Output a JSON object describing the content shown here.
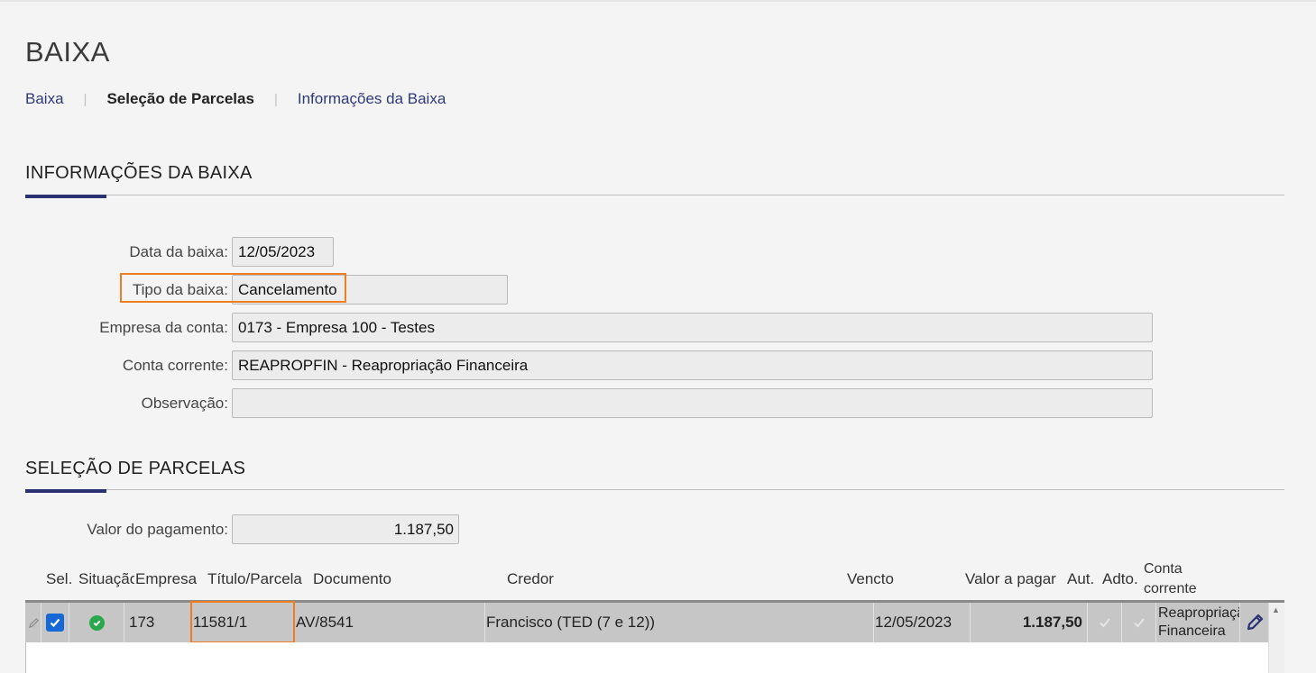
{
  "page": {
    "title": "BAIXA"
  },
  "breadcrumb": {
    "items": [
      {
        "label": "Baixa"
      },
      {
        "label": "Seleção de Parcelas"
      },
      {
        "label": "Informações da Baixa"
      }
    ],
    "separator": "|"
  },
  "info_section": {
    "title": "INFORMAÇÕES DA BAIXA",
    "data_baixa": {
      "label": "Data da baixa:",
      "value": "12/05/2023"
    },
    "tipo_baixa": {
      "label": "Tipo da baixa:",
      "value": "Cancelamento"
    },
    "empresa": {
      "label": "Empresa da conta:",
      "value": "0173 - Empresa 100 - Testes"
    },
    "conta": {
      "label": "Conta corrente:",
      "value": "REAPROPFIN - Reapropriação Financeira"
    },
    "observacao": {
      "label": "Observação:",
      "value": ""
    }
  },
  "selection_section": {
    "title": "SELEÇÃO DE PARCELAS",
    "valor_pagamento": {
      "label": "Valor do pagamento:",
      "value": "1.187,50"
    },
    "columns": {
      "sel": "Sel.",
      "situacao": "Situação",
      "empresa": "Empresa",
      "titulo": "Título/Parcela",
      "documento": "Documento",
      "credor": "Credor",
      "vencto": "Vencto",
      "valor": "Valor a pagar",
      "aut": "Aut.",
      "adto": "Adto.",
      "conta_line1": "Conta",
      "conta_line2": "corrente"
    },
    "rows": [
      {
        "selected": true,
        "situacao": "ok",
        "empresa": "173",
        "titulo": "11581/1",
        "documento": "AV/8541",
        "credor": "Francisco (TED (7 e 12))",
        "vencto": "12/05/2023",
        "valor": "1.187,50",
        "conta_line1": "Reapropriação",
        "conta_line2": "Financeira"
      }
    ]
  },
  "colors": {
    "accent": "#2a3170",
    "link": "#2e3a7a",
    "highlight": "#ef7d22",
    "checkbox": "#1668d6",
    "status_ok": "#2aa94c"
  },
  "icons": {
    "row_edit": "pencil-icon",
    "situacao": "check-circle-icon",
    "row_action": "edit-pencil-icon",
    "scroll_up": "triangle-up-icon"
  }
}
